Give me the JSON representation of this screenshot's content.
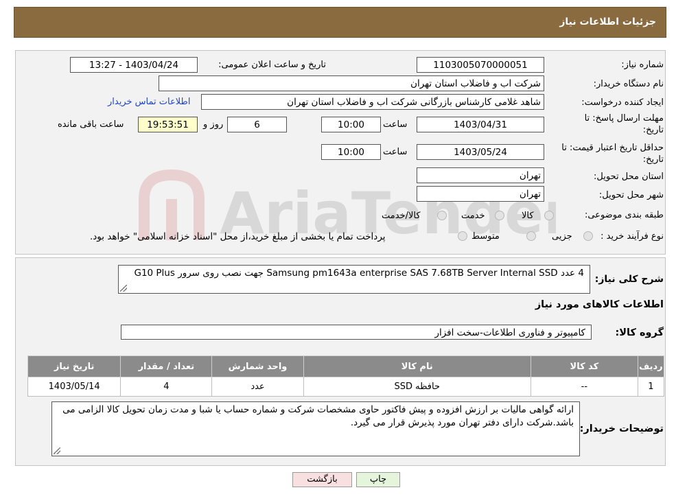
{
  "header": {
    "title": "جزئیات اطلاعات نیاز"
  },
  "fields": {
    "need_number_label": "شماره نیاز:",
    "need_number": "1103005070000051",
    "announce_datetime_label": "تاریخ و ساعت اعلان عمومی:",
    "announce_datetime": "1403/04/24 - 13:27",
    "buyer_org_label": "نام دستگاه خریدار:",
    "buyer_org": "شرکت اب و فاضلاب استان تهران",
    "requester_label": "ایجاد کننده درخواست:",
    "requester": "شاهد غلامی کارشناس بازرگانی شرکت اب و فاضلاب استان تهران",
    "contact_link": "اطلاعات تماس خریدار",
    "reply_deadline_label_1": "مهلت ارسال پاسخ: تا",
    "reply_deadline_label_2": "تاریخ:",
    "reply_date": "1403/04/31",
    "time_label": "ساعت",
    "reply_time": "10:00",
    "days_value": "6",
    "days_label": "روز و",
    "remaining_time": "19:53:51",
    "remaining_label": "ساعت باقی مانده",
    "validity_label_1": "حداقل تاریخ اعتبار قیمت: تا",
    "validity_label_2": "تاریخ:",
    "validity_date": "1403/05/24",
    "validity_time": "10:00",
    "province_label": "استان محل تحویل:",
    "province": "تهران",
    "city_label": "شهر محل تحویل:",
    "city": "تهران",
    "category_label": "طبقه بندی موضوعی:",
    "category_options": [
      "کالا",
      "خدمت",
      "کالا/خدمت"
    ],
    "process_label": "نوع فرآیند خرید :",
    "process_options": [
      "جزیی",
      "متوسط"
    ],
    "process_note": "پرداخت تمام یا بخشی از مبلغ خرید،از محل \"اسناد خزانه اسلامی\" خواهد بود."
  },
  "summary": {
    "label": "شرح کلی نیاز:",
    "text": "4 عدد Samsung pm1643a enterprise SAS 7.68TB Server Internal SSD  جهت نصب روی سرور G10 Plus"
  },
  "goods": {
    "section_title": "اطلاعات کالاهای مورد نیاز",
    "group_label": "گروه کالا:",
    "group_value": "کامپیوتر و فناوری اطلاعات-سخت افزار",
    "table": {
      "headers": [
        "ردیف",
        "کد کالا",
        "نام کالا",
        "واحد شمارش",
        "تعداد / مقدار",
        "تاریخ نیاز"
      ],
      "rows": [
        [
          "1",
          "--",
          "حافظه SSD",
          "عدد",
          "4",
          "1403/05/14"
        ]
      ]
    }
  },
  "buyer_notes": {
    "label": "توضیحات خریدار:",
    "text": "ارائه گواهی مالیات بر ارزش افزوده و پیش فاکتور حاوی مشخصات شرکت و شماره حساب یا شبا و مدت زمان تحویل کالا الزامی می باشد.شرکت دارای دفتر تهران مورد پذیرش قرار می گیرد."
  },
  "buttons": {
    "print": "چاپ",
    "back": "بازگشت"
  },
  "watermark": "AriaTender.neT",
  "colors": {
    "header_bg": "#8a6a3f",
    "table_header_bg": "#8b8b8b",
    "back_button_bg": "#f8e0e0",
    "print_button_bg": "#e4f5dc"
  }
}
